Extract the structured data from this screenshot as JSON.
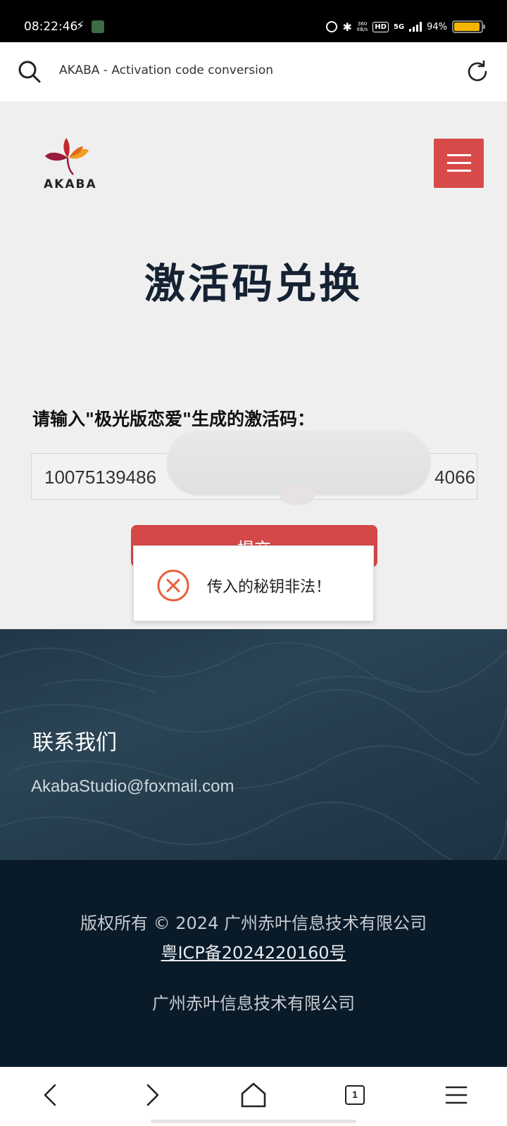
{
  "status_bar": {
    "time": "08:22:46",
    "network_speed_top": "360",
    "network_speed_bottom": "KB/s",
    "hd": "HD",
    "network_type": "5G",
    "battery_percent": "94%",
    "battery_level": 0.94,
    "battery_color": "#f5b400"
  },
  "browser": {
    "address_text": "AKABA - Activation code conversion"
  },
  "header": {
    "logo_text": "AKABA",
    "menu_color": "#d84a4a"
  },
  "main": {
    "title": "激活码兑换",
    "input_label": "请输入\"极光版恋爱\"生成的激活码：",
    "code_prefix": "10075139486",
    "code_suffix": "4066",
    "submit_label": "提交"
  },
  "toast": {
    "message": "传入的秘钥非法！",
    "icon": "error-x-icon"
  },
  "contact": {
    "title": "联系我们",
    "email": "AkabaStudio@foxmail.com"
  },
  "footer": {
    "copyright": "版权所有 © 2024 广州赤叶信息技术有限公司",
    "icp": "粤ICP备2024220160号",
    "company": "广州赤叶信息技术有限公司"
  },
  "bottom_nav": {
    "items": [
      "back-icon",
      "forward-icon",
      "home-icon",
      "tabs-icon",
      "menu-icon"
    ],
    "tab_count": "1"
  }
}
